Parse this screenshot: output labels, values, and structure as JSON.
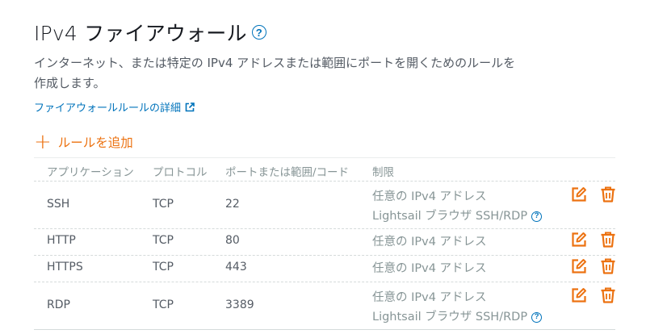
{
  "header": {
    "title": "IPv4 ファイアウォール",
    "help_glyph": "?"
  },
  "description": "インターネット、または特定の IPv4 アドレスまたは範囲にポートを開くためのルールを作成します。",
  "details_link": {
    "label": "ファイアウォールルールの詳細",
    "icon": "external-link-icon"
  },
  "add_rule": {
    "plus": "+",
    "label": "ルールを追加"
  },
  "table": {
    "columns": [
      "アプリケーション",
      "プロトコル",
      "ポートまたは範囲/コード",
      "制限"
    ],
    "rows": [
      {
        "application": "SSH",
        "protocol": "TCP",
        "port": "22",
        "restriction": "任意の IPv4 アドレス",
        "sub": "Lightsail ブラウザ SSH/RDP"
      },
      {
        "application": "HTTP",
        "protocol": "TCP",
        "port": "80",
        "restriction": "任意の IPv4 アドレス",
        "sub": ""
      },
      {
        "application": "HTTPS",
        "protocol": "TCP",
        "port": "443",
        "restriction": "任意の IPv4 アドレス",
        "sub": ""
      },
      {
        "application": "RDP",
        "protocol": "TCP",
        "port": "3389",
        "restriction": "任意の IPv4 アドレス",
        "sub": "Lightsail ブラウザ SSH/RDP"
      }
    ]
  },
  "colors": {
    "accent": "#ec7211",
    "link": "#0073bb",
    "muted": "#879596",
    "text": "#545b64"
  },
  "icons": {
    "edit": "edit-icon",
    "delete": "trash-icon",
    "help": "help-icon"
  }
}
